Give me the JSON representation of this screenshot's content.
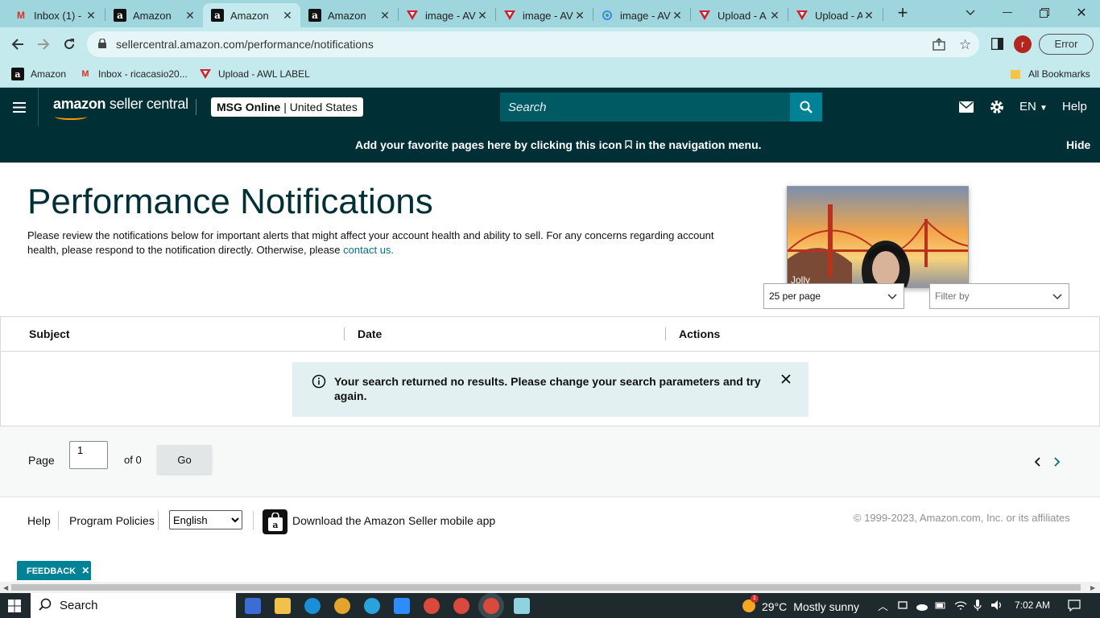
{
  "browser": {
    "tabs": [
      {
        "title": "Inbox (1) -",
        "icon": "gmail-icon"
      },
      {
        "title": "Amazon",
        "icon": "amazon-icon"
      },
      {
        "title": "Amazon",
        "icon": "amazon-icon",
        "active": true
      },
      {
        "title": "Amazon",
        "icon": "amazon-icon"
      },
      {
        "title": "image - AV",
        "icon": "awl-icon"
      },
      {
        "title": "image - AV",
        "icon": "awl-icon"
      },
      {
        "title": "image - AV",
        "icon": "google-lens-icon"
      },
      {
        "title": "Upload - A",
        "icon": "awl-icon"
      },
      {
        "title": "Upload - A",
        "icon": "awl-icon"
      }
    ],
    "url": "sellercentral.amazon.com/performance/notifications",
    "profile_initial": "r",
    "error_label": "Error",
    "bookmarks": [
      {
        "label": "Amazon",
        "icon": "amazon-icon"
      },
      {
        "label": "Inbox - ricacasio20...",
        "icon": "gmail-icon"
      },
      {
        "label": "Upload - AWL LABEL",
        "icon": "awl-icon"
      }
    ],
    "all_bookmarks": "All Bookmarks"
  },
  "header": {
    "logo_brand": "amazon",
    "logo_product": "seller central",
    "account_name": "MSG Online",
    "account_region": "United States",
    "search_placeholder": "Search",
    "language": "EN",
    "help": "Help"
  },
  "banner": {
    "message": "Add your favorite pages here by clicking this icon",
    "message_suffix": "in the navigation menu.",
    "hide": "Hide"
  },
  "main": {
    "title": "Performance Notifications",
    "description": "Please review the notifications below for important alerts that might affect your account health and ability to sell. For any concerns regarding account health, please respond to the notification directly. Otherwise, please",
    "contact_link": "contact us.",
    "video_caption": "Jolly",
    "per_page": "25 per page",
    "filter_placeholder": "Filter by",
    "table": {
      "columns": [
        "Subject",
        "Date",
        "Actions"
      ],
      "empty_message": "Your search returned no results. Please change your search parameters and try again."
    },
    "pager": {
      "label": "Page",
      "current": "1",
      "of_label": "of 0",
      "go": "Go"
    }
  },
  "footer": {
    "help": "Help",
    "program_policies": "Program Policies",
    "language_selected": "English",
    "app_download": "Download the Amazon Seller mobile app",
    "copyright": "© 1999-2023, Amazon.com, Inc. or its affiliates",
    "feedback": "FEEDBACK"
  },
  "taskbar": {
    "search": "Search",
    "temperature": "29°C",
    "weather": "Mostly sunny",
    "time": "7:02 AM",
    "weather_badge": "1"
  },
  "colors": {
    "header_bg": "#002f36",
    "accent_teal": "#008296",
    "link": "#007185",
    "alert_bg": "#e3f0f1",
    "browser_chrome": "#c5eaee"
  }
}
